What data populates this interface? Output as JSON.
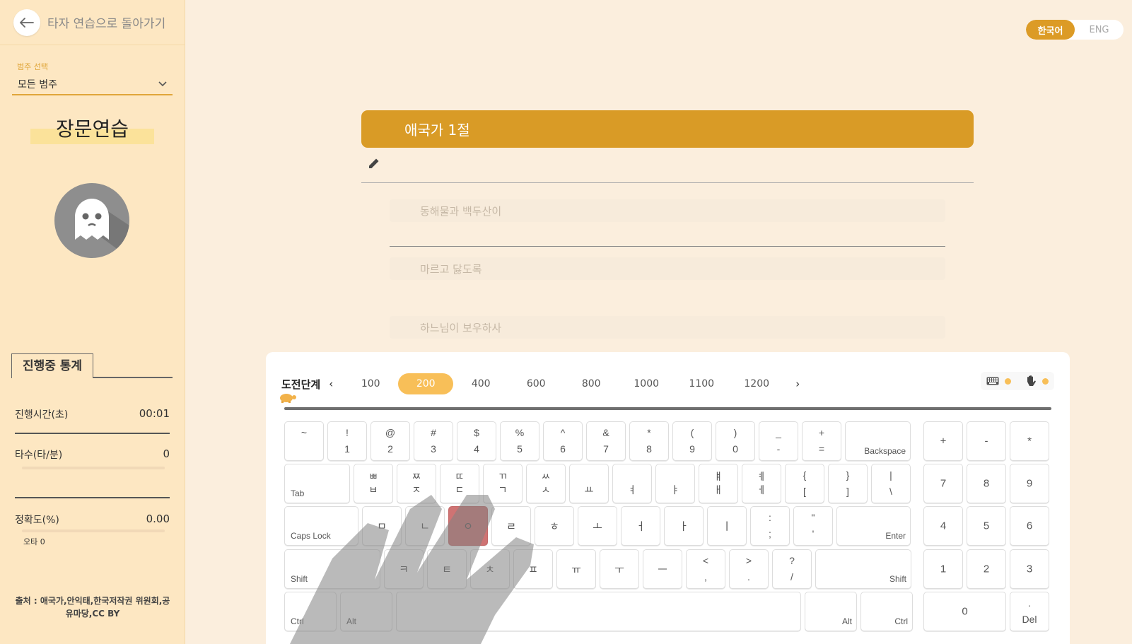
{
  "sidebar": {
    "back_label": "타자 연습으로 돌아가기",
    "category_label": "범주 선택",
    "category_value": "모든 범주",
    "mode_title": "장문연습",
    "stats_title": "진행중 통계",
    "stats": {
      "time_label": "진행시간(초)",
      "time_value": "00:01",
      "speed_label": "타수(타/분)",
      "speed_value": "0",
      "accuracy_label": "정확도(%)",
      "accuracy_value": "0.00",
      "typo_label": "오타 0"
    },
    "source": "출처 : 애국가,안익태,한국저작권 위원회,공유마당,CC BY"
  },
  "lang": {
    "korean": "한국어",
    "english": "ENG"
  },
  "song": {
    "title": "애국가 1절",
    "lines": [
      "동해물과 백두산이",
      "마르고 닳도록",
      "하느님이 보우하사"
    ]
  },
  "keyboard": {
    "level_label": "도전단계",
    "levels": [
      "100",
      "200",
      "400",
      "600",
      "800",
      "1000",
      "1100",
      "1200"
    ],
    "selected_level": "200",
    "rows": {
      "num": [
        {
          "top": "~",
          "bottom": ""
        },
        {
          "top": "!",
          "bottom": "1"
        },
        {
          "top": "@",
          "bottom": "2"
        },
        {
          "top": "#",
          "bottom": "3"
        },
        {
          "top": "$",
          "bottom": "4"
        },
        {
          "top": "%",
          "bottom": "5"
        },
        {
          "top": "^",
          "bottom": "6"
        },
        {
          "top": "&",
          "bottom": "7"
        },
        {
          "top": "*",
          "bottom": "8"
        },
        {
          "top": "(",
          "bottom": "9"
        },
        {
          "top": ")",
          "bottom": "0"
        },
        {
          "top": "_",
          "bottom": "-"
        },
        {
          "top": "+",
          "bottom": "="
        }
      ],
      "backspace": "Backspace",
      "tab": "Tab",
      "top": [
        {
          "top": "ㅃ",
          "bottom": "ㅂ"
        },
        {
          "top": "ㅉ",
          "bottom": "ㅈ"
        },
        {
          "top": "ㄸ",
          "bottom": "ㄷ"
        },
        {
          "top": "ㄲ",
          "bottom": "ㄱ"
        },
        {
          "top": "ㅆ",
          "bottom": "ㅅ"
        },
        {
          "top": "",
          "bottom": "ㅛ"
        },
        {
          "top": "",
          "bottom": "ㅕ"
        },
        {
          "top": "",
          "bottom": "ㅑ"
        },
        {
          "top": "ㅒ",
          "bottom": "ㅐ"
        },
        {
          "top": "ㅖ",
          "bottom": "ㅔ"
        },
        {
          "top": "{",
          "bottom": "["
        },
        {
          "top": "}",
          "bottom": "]"
        },
        {
          "top": "|",
          "bottom": "\\"
        }
      ],
      "caps": "Caps Lock",
      "home": [
        "ㅁ",
        "ㄴ",
        "ㅇ",
        "ㄹ",
        "ㅎ",
        "ㅗ",
        "ㅓ",
        "ㅏ",
        "ㅣ"
      ],
      "home_punct": [
        {
          "top": ":",
          "bottom": ";"
        },
        {
          "top": "\"",
          "bottom": "'"
        }
      ],
      "enter": "Enter",
      "shift": "Shift",
      "bottom": [
        "ㅋ",
        "ㅌ",
        "ㅊ",
        "ㅍ",
        "ㅠ",
        "ㅜ",
        "ㅡ"
      ],
      "bottom_punct": [
        {
          "top": "<",
          "bottom": ","
        },
        {
          "top": ">",
          "bottom": "."
        },
        {
          "top": "?",
          "bottom": "/"
        }
      ],
      "ctrl": "Ctrl",
      "alt": "Alt"
    },
    "highlighted_key": "ㅇ",
    "numpad": [
      "+",
      "-",
      "*",
      "7",
      "8",
      "9",
      "4",
      "5",
      "6",
      "1",
      "2",
      "3",
      "0",
      "."
    ],
    "del": "Del"
  },
  "colors": {
    "accent": "#d99b26",
    "highlight_key": "#cf7373",
    "sidebar_bg": "#fde7c2",
    "page_bg": "#fbeedd"
  }
}
